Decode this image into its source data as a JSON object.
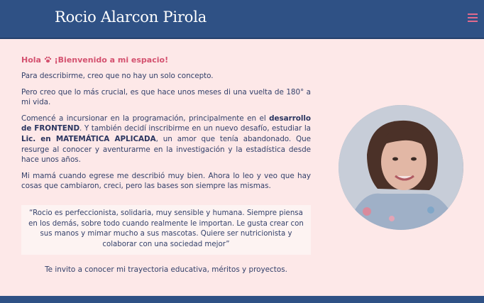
{
  "header": {
    "title": "Rocio Alarcon Pirola",
    "menu_icon": "hamburger-menu-icon",
    "background": "#2f5185",
    "accent": "#e06a8d"
  },
  "intro": {
    "greeting_prefix": "Hola",
    "greeting_icon": "paw-icon",
    "greeting_suffix": "¡Bienvenido a mi espacio!",
    "p1": "Para describirme, creo que no hay un solo concepto.",
    "p2": "Pero creo que lo más crucial, es que hace unos meses di una vuelta de 180° a mi vida.",
    "p3_a": "Comencé a incursionar en la programación, principalmente en el ",
    "p3_b": "desarrollo de FRONTEND",
    "p3_c": ". Y también decidí inscribirme en un nuevo desafío, estudiar la ",
    "p3_d": "Lic. en MATEMÁTICA APLICADA",
    "p3_e": ", un amor que tenía abandonado. Que resurge al conocer y aventurarme en la investigación y la estadística desde hace unos años.",
    "p4": "Mi mamá cuando egrese me describió muy bien. Ahora lo leo y veo que hay cosas que cambiaron, creci, pero las bases son siempre las mismas."
  },
  "quote": "“Rocio es perfeccionista, solidaria, muy sensible y humana. Siempre piensa en los demás, sobre todo cuando realmente le importan. Le gusta crear con sus manos y mimar mucho a sus mascotas. Quiere ser nutricionista y colaborar con una sociedad mejor”",
  "invite": "Te invito a conocer mi trayectoria educativa, méritos y proyectos.",
  "colors": {
    "page_background": "#fde8e8",
    "greeting": "#d4516f",
    "text": "#33406a"
  }
}
